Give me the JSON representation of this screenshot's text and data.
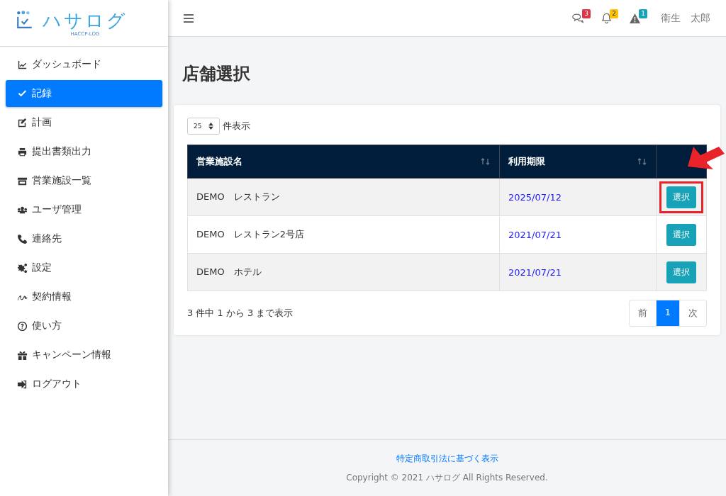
{
  "logo": {
    "name": "ハサログ",
    "sub": "HACCP-LOG"
  },
  "sidebar": {
    "items": [
      {
        "label": "ダッシュボード",
        "selected": false
      },
      {
        "label": "記録",
        "selected": true
      },
      {
        "label": "計画",
        "selected": false
      },
      {
        "label": "提出書類出力",
        "selected": false
      },
      {
        "label": "営業施設一覧",
        "selected": false
      },
      {
        "label": "ユーザ管理",
        "selected": false
      },
      {
        "label": "連絡先",
        "selected": false
      },
      {
        "label": "設定",
        "selected": false
      },
      {
        "label": "契約情報",
        "selected": false
      },
      {
        "label": "使い方",
        "selected": false
      },
      {
        "label": "キャンペーン情報",
        "selected": false
      },
      {
        "label": "ログアウト",
        "selected": false
      }
    ]
  },
  "header": {
    "notifications": [
      {
        "count": "3",
        "color": "#dc3545"
      },
      {
        "count": "2",
        "color": "#ffc107"
      },
      {
        "count": "1",
        "color": "#17a2b8"
      }
    ],
    "user": "衛生　太郎"
  },
  "page_title": "店舗選択",
  "length_select": {
    "value": "25",
    "label": "件表示"
  },
  "table": {
    "columns": [
      {
        "label": "営業施設名",
        "sortable": true
      },
      {
        "label": "利用期限",
        "sortable": true
      },
      {
        "sortable": false
      }
    ],
    "rows": [
      {
        "name": "DEMO　レストラン",
        "expiry": "2025/07/12",
        "button": "選択",
        "highlighted": true
      },
      {
        "name": "DEMO　レストラン2号店",
        "expiry": "2021/07/21",
        "button": "選択",
        "highlighted": false
      },
      {
        "name": "DEMO　ホテル",
        "expiry": "2021/07/21",
        "button": "選択",
        "highlighted": false
      }
    ]
  },
  "info": "3 件中 1 から 3 まで表示",
  "pagination": [
    {
      "label": "前",
      "selected": false
    },
    {
      "label": "1",
      "selected": true
    },
    {
      "label": "次",
      "selected": false
    }
  ],
  "footer": {
    "link": "特定商取引法に基づく表示",
    "copyright": "Copyright © 2021 ハサログ All Rights Reserved."
  }
}
